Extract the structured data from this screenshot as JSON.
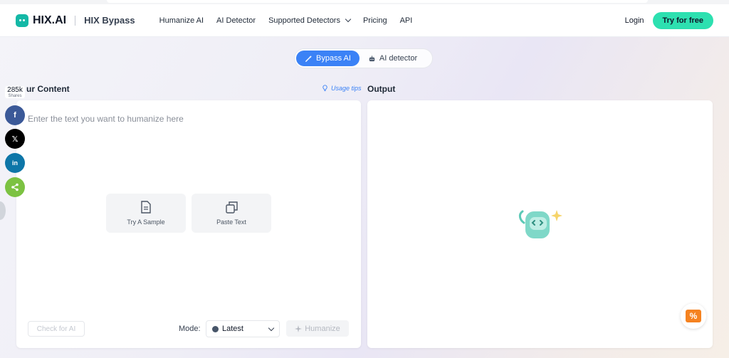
{
  "header": {
    "logo": "HIX.AI",
    "sub_brand": "HIX Bypass",
    "nav": [
      {
        "label": "Humanize AI"
      },
      {
        "label": "AI Detector"
      },
      {
        "label": "Supported Detectors"
      },
      {
        "label": "Pricing"
      },
      {
        "label": "API"
      }
    ],
    "login": "Login",
    "cta": "Try for free"
  },
  "tabs": [
    {
      "label": "Bypass AI",
      "icon": "magic-wand-icon",
      "active": true
    },
    {
      "label": "AI detector",
      "icon": "robot-icon",
      "active": false
    }
  ],
  "input": {
    "title": "ur Content",
    "usage_tips": "Usage tips",
    "placeholder": "Enter the text you want to humanize here",
    "try_sample": "Try A Sample",
    "paste_text": "Paste Text",
    "check_ai": "Check for AI",
    "mode_label": "Mode:",
    "mode_value": "Latest",
    "humanize": "Humanize"
  },
  "output": {
    "title": "Output"
  },
  "share": {
    "count": "285k",
    "label": "Shares",
    "x_glyph": "𝕏",
    "fb_glyph": "f",
    "li_glyph": "in"
  },
  "colors": {
    "accent": "#3b82f6",
    "cta": "#2de0b0",
    "brand": "#14b8a6"
  }
}
